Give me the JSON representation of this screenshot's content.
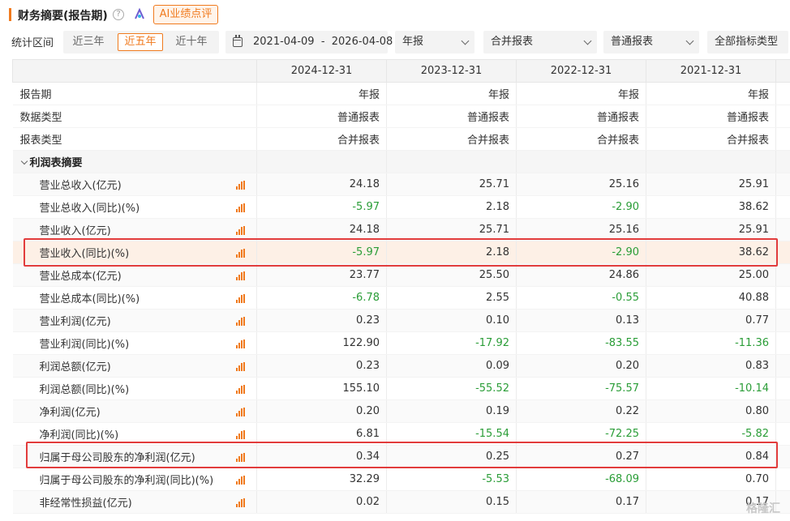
{
  "header": {
    "title": "财务摘要(报告期)",
    "help_icon": "question-icon",
    "ai_button": "AI业绩点评"
  },
  "filters": {
    "label": "统计区间",
    "ranges": [
      "近三年",
      "近五年",
      "近十年"
    ],
    "active_range": "近五年",
    "date_range": "2021-04-09  -  2026-04-08",
    "period_select": "年报",
    "consolidation_select": "合并报表",
    "report_type_select": "普通报表",
    "indicator_select": "全部指标类型"
  },
  "colors": {
    "accent": "#f07a1e",
    "negative": "#2a9d37",
    "highlight_row": "#fdf0e6",
    "red_box": "#e23c3c"
  },
  "table": {
    "columns": [
      "2024-12-31",
      "2023-12-31",
      "2022-12-31",
      "2021-12-31"
    ],
    "meta_rows": [
      {
        "label": "报告期",
        "values": [
          "年报",
          "年报",
          "年报",
          "年报"
        ]
      },
      {
        "label": "数据类型",
        "values": [
          "普通报表",
          "普通报表",
          "普通报表",
          "普通报表"
        ]
      },
      {
        "label": "报表类型",
        "values": [
          "合并报表",
          "合并报表",
          "合并报表",
          "合并报表"
        ]
      }
    ],
    "section": "利润表摘要",
    "rows": [
      {
        "label": "营业总收入(亿元)",
        "values": [
          "24.18",
          "25.71",
          "25.16",
          "25.91"
        ]
      },
      {
        "label": "营业总收入(同比)(%)",
        "values": [
          "-5.97",
          "2.18",
          "-2.90",
          "38.62"
        ]
      },
      {
        "label": "营业收入(亿元)",
        "values": [
          "24.18",
          "25.71",
          "25.16",
          "25.91"
        ]
      },
      {
        "label": "营业收入(同比)(%)",
        "values": [
          "-5.97",
          "2.18",
          "-2.90",
          "38.62"
        ]
      },
      {
        "label": "营业总成本(亿元)",
        "values": [
          "23.77",
          "25.50",
          "24.86",
          "25.00"
        ]
      },
      {
        "label": "营业总成本(同比)(%)",
        "values": [
          "-6.78",
          "2.55",
          "-0.55",
          "40.88"
        ]
      },
      {
        "label": "营业利润(亿元)",
        "values": [
          "0.23",
          "0.10",
          "0.13",
          "0.77"
        ]
      },
      {
        "label": "营业利润(同比)(%)",
        "values": [
          "122.90",
          "-17.92",
          "-83.55",
          "-11.36"
        ]
      },
      {
        "label": "利润总额(亿元)",
        "values": [
          "0.23",
          "0.09",
          "0.20",
          "0.83"
        ]
      },
      {
        "label": "利润总额(同比)(%)",
        "values": [
          "155.10",
          "-55.52",
          "-75.57",
          "-10.14"
        ]
      },
      {
        "label": "净利润(亿元)",
        "values": [
          "0.20",
          "0.19",
          "0.22",
          "0.80"
        ]
      },
      {
        "label": "净利润(同比)(%)",
        "values": [
          "6.81",
          "-15.54",
          "-72.25",
          "-5.82"
        ]
      },
      {
        "label": "归属于母公司股东的净利润(亿元)",
        "values": [
          "0.34",
          "0.25",
          "0.27",
          "0.84"
        ]
      },
      {
        "label": "归属于母公司股东的净利润(同比)(%)",
        "values": [
          "32.29",
          "-5.53",
          "-68.09",
          "0.70"
        ]
      },
      {
        "label": "非经常性损益(亿元)",
        "values": [
          "0.02",
          "0.15",
          "0.17",
          "0.17"
        ]
      }
    ]
  },
  "watermark": "格隆汇"
}
